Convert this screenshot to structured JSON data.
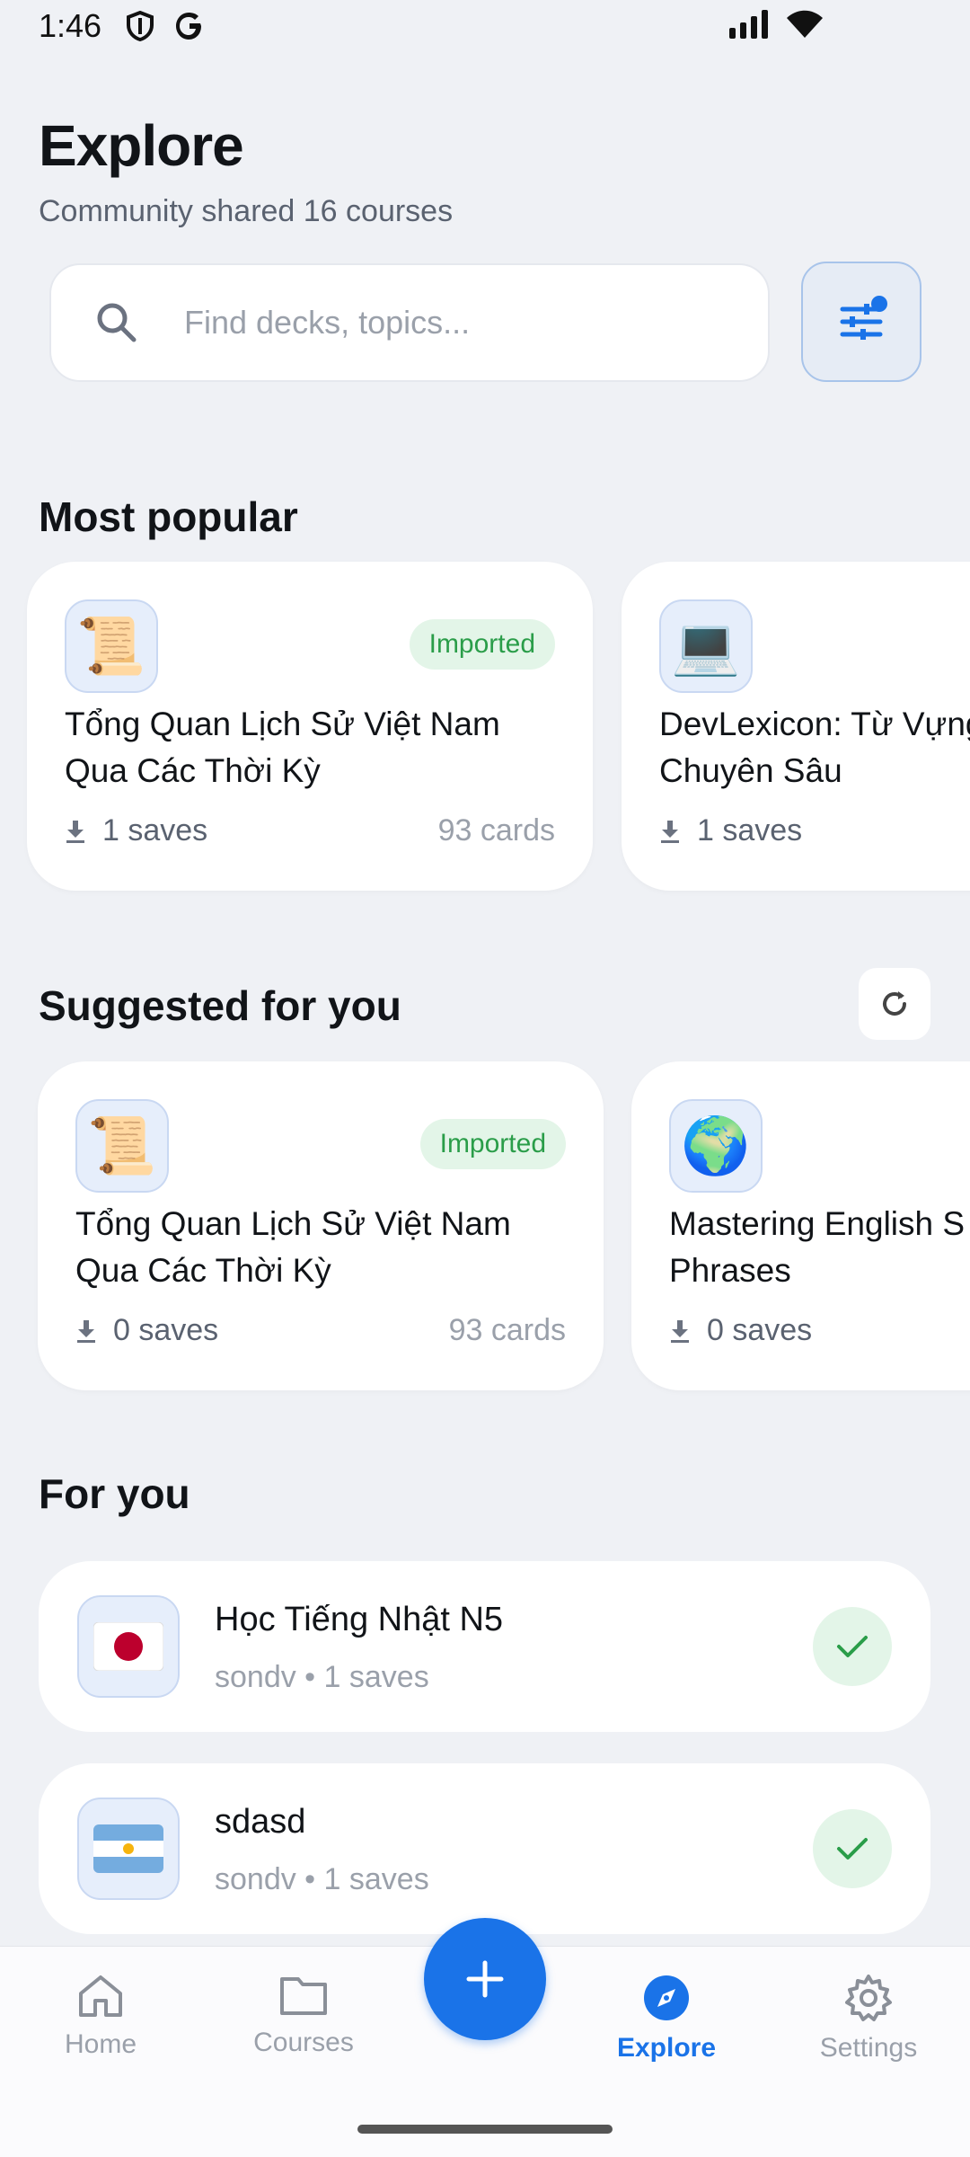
{
  "status_bar": {
    "time": "1:46",
    "left_icons": [
      "shield-icon",
      "google-icon"
    ],
    "right_icons": [
      "signal-icon",
      "wifi-icon"
    ]
  },
  "header": {
    "title": "Explore",
    "subtitle": "Community shared 16 courses"
  },
  "search": {
    "placeholder": "Find decks, topics..."
  },
  "sections": {
    "most_popular": "Most popular",
    "suggested": "Suggested for you",
    "for_you": "For you"
  },
  "most_popular": [
    {
      "emoji": "📜",
      "badge": "Imported",
      "title": "Tổng Quan Lịch Sử Việt Nam Qua Các Thời Kỳ",
      "saves": "1 saves",
      "cards": "93 cards"
    },
    {
      "emoji": "💻",
      "badge": "",
      "title": "DevLexicon: Từ Vựng Chuyên Sâu",
      "saves": "1 saves",
      "cards": ""
    }
  ],
  "suggested": [
    {
      "emoji": "📜",
      "badge": "Imported",
      "title": "Tổng Quan Lịch Sử Việt Nam Qua Các Thời Kỳ",
      "saves": "0 saves",
      "cards": "93 cards"
    },
    {
      "emoji": "🌍",
      "badge": "",
      "title": "Mastering English S Phrases",
      "saves": "0 saves",
      "cards": ""
    }
  ],
  "for_you": [
    {
      "flag": "japan",
      "title": "Học Tiếng Nhật N5",
      "meta": "sondv • 1 saves"
    },
    {
      "flag": "argentina",
      "title": "sdasd",
      "meta": "sondv • 1 saves"
    }
  ],
  "nav": {
    "home": "Home",
    "courses": "Courses",
    "explore": "Explore",
    "settings": "Settings",
    "active": "explore"
  },
  "colors": {
    "accent": "#1a73e8",
    "success": "#2a9d49",
    "background": "#eff1f5"
  }
}
